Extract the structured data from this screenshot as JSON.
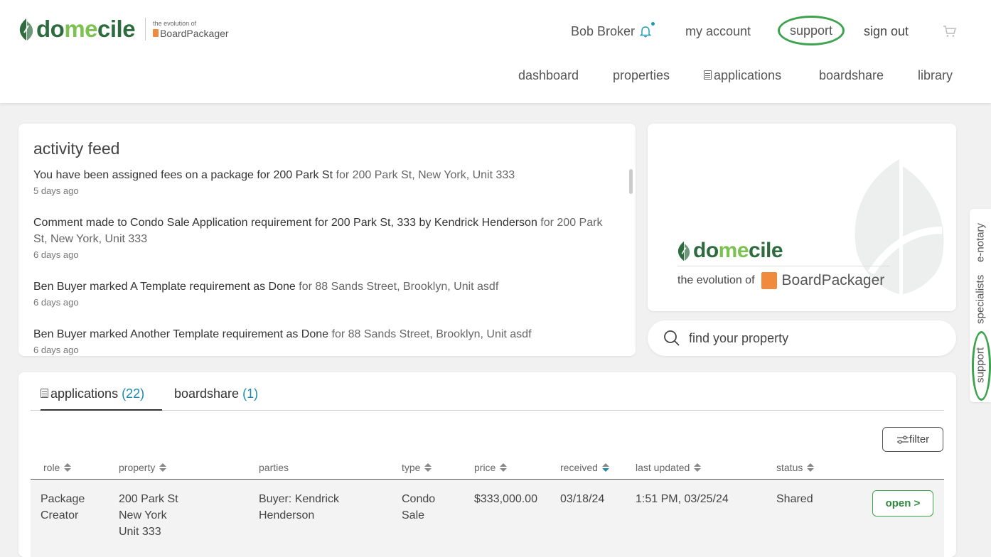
{
  "brand": {
    "word_a": "do",
    "word_b": "me",
    "word_c": "cile",
    "tagline_top": "the evolution of",
    "tagline_product": "BoardPackager"
  },
  "topnav": {
    "user": "Bob Broker",
    "my_account": "my account",
    "support": "support",
    "sign_out": "sign out"
  },
  "mainnav": {
    "dashboard": "dashboard",
    "properties": "properties",
    "applications": "applications",
    "boardshare": "boardshare",
    "library": "library"
  },
  "feed": {
    "title": "activity feed",
    "items": [
      {
        "action": "You have been assigned fees on a package for 200 Park St",
        "detail": " for 200 Park St, New York, Unit 333",
        "when": "5 days ago"
      },
      {
        "action": "Comment made to Condo Sale Application requirement for 200 Park St, 333 by Kendrick Henderson",
        "detail": " for 200 Park St, New York, Unit 333",
        "when": "6 days ago"
      },
      {
        "action": "Ben Buyer marked A Template requirement as Done",
        "detail": " for 88 Sands Street, Brooklyn, Unit asdf",
        "when": "6 days ago"
      },
      {
        "action": "Ben Buyer marked Another Template requirement as Done",
        "detail": " for 88 Sands Street, Brooklyn, Unit asdf",
        "when": "6 days ago"
      }
    ]
  },
  "promo": {
    "evolution": "the evolution of",
    "product": "BoardPackager"
  },
  "search": {
    "placeholder": "find your property"
  },
  "side_tabs": {
    "enotary": "e-notary",
    "specialists": "specialists",
    "support": "support"
  },
  "apps_panel": {
    "tab_apps": "applications",
    "tab_apps_count": "(22)",
    "tab_board": "boardshare",
    "tab_board_count": "(1)",
    "filter": "filter",
    "columns": {
      "role": "role",
      "property": "property",
      "parties": "parties",
      "type": "type",
      "price": "price",
      "received": "received",
      "last_updated": "last updated",
      "status": "status"
    },
    "rows": [
      {
        "role_1": "Package",
        "role_2": "Creator",
        "property_1": "200 Park St",
        "property_2": "New York",
        "property_3": "Unit 333",
        "parties_1": "Buyer: Kendrick",
        "parties_2": "Henderson",
        "type_1": "Condo",
        "type_2": "Sale",
        "price": "$333,000.00",
        "received": "03/18/24",
        "last_updated": "1:51 PM, 03/25/24",
        "status": "Shared",
        "action": "open >"
      }
    ]
  },
  "colors": {
    "brand_dark": "#2e6b3e",
    "brand_light": "#7cc250",
    "accent_teal": "#1a8ba8",
    "highlight_ring": "#3ea34f",
    "bp_orange": "#f08a3c"
  }
}
